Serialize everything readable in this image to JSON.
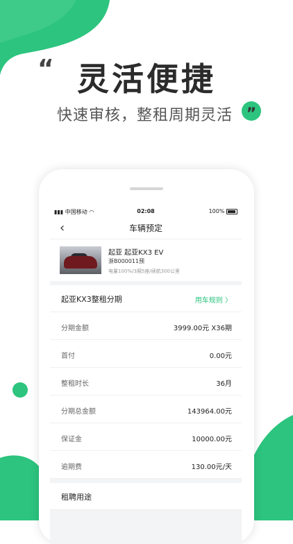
{
  "colors": {
    "accent": "#2cc47e",
    "accent_dark": "#14b36e"
  },
  "promo": {
    "headline": "灵活便捷",
    "subline": "快速审核，整租周期灵活",
    "open_quote": "“",
    "close_quote": "”"
  },
  "status_bar": {
    "carrier": "中国移动",
    "time": "02:08",
    "battery": "100%"
  },
  "nav": {
    "back_glyph": "‹",
    "title": "车辆预定"
  },
  "car": {
    "title": "起亚 起亚KX3 EV",
    "plate": "浙B000011预",
    "info": "电量100%/3厢5座/续航300公里"
  },
  "plan": {
    "title": "起亚KX3整租分期",
    "link": "用车规则 〉",
    "rows": [
      {
        "label": "分期金额",
        "value": "3999.00元 X36期"
      },
      {
        "label": "首付",
        "value": "0.00元"
      },
      {
        "label": "整租时长",
        "value": "36月"
      },
      {
        "label": "分期总金额",
        "value": "143964.00元"
      },
      {
        "label": "保证金",
        "value": "10000.00元"
      },
      {
        "label": "逾期费",
        "value": "130.00元/天"
      }
    ]
  },
  "usage": {
    "title": "租聘用途"
  }
}
